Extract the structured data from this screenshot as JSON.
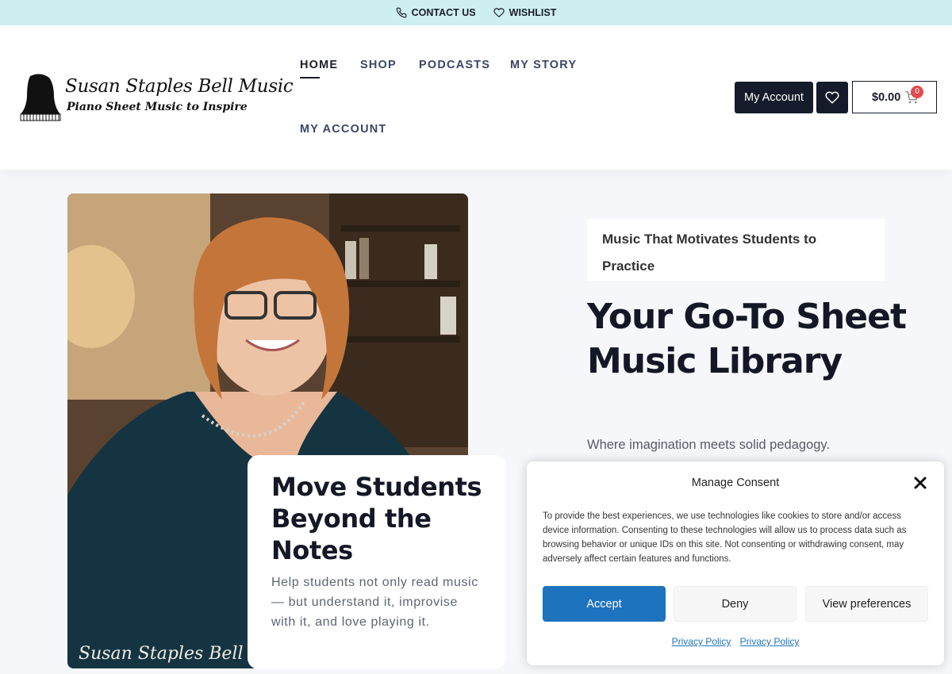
{
  "topbar": {
    "contact_label": "CONTACT US",
    "wishlist_label": "WISHLIST"
  },
  "logo": {
    "name": "Susan Staples Bell Music",
    "tagline": "Piano Sheet Music to Inspire"
  },
  "nav": {
    "items": [
      {
        "label": "HOME"
      },
      {
        "label": "SHOP"
      },
      {
        "label": "PODCASTS"
      },
      {
        "label": "MY STORY"
      },
      {
        "label": "MY ACCOUNT"
      }
    ]
  },
  "header_actions": {
    "account_label": "My Account",
    "cart_amount": "$0.00",
    "cart_count": "0"
  },
  "photo": {
    "signature": "Susan Staples Bell"
  },
  "card": {
    "title": "Move Students Beyond the Notes",
    "text": "Help students not only read music — but understand it, improvise with it, and love playing it."
  },
  "hero": {
    "tagline": "Music That Motivates Students to Practice",
    "title": "Your Go-To Sheet Music Library",
    "subtitle": "Where imagination meets solid pedagogy."
  },
  "consent": {
    "title": "Manage Consent",
    "body": "To provide the best experiences, we use technologies like cookies to store and/or access device information. Consenting to these technologies will allow us to process data such as browsing behavior or unique IDs on this site. Not consenting or withdrawing consent, may adversely affect certain features and functions.",
    "accept_label": "Accept",
    "deny_label": "Deny",
    "preferences_label": "View preferences",
    "link1": "Privacy Policy",
    "link2": "Privacy Policy"
  },
  "colors": {
    "topbar_bg": "#cdeff1",
    "dark_button": "#151b2a",
    "accept_blue": "#1e73be",
    "badge_red": "#e24b4b"
  }
}
